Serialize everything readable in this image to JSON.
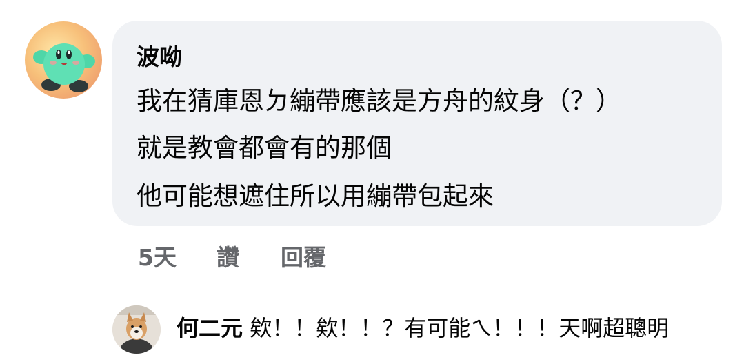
{
  "comment": {
    "author": "波呦",
    "lines": [
      "我在猜庫恩ㄉ繃帶應該是方舟的紋身（？）",
      "就是教會都會有的那個",
      "他可能想遮住所以用繃帶包起來"
    ]
  },
  "actions": {
    "time": "5天",
    "like": "讚",
    "reply": "回覆"
  },
  "reply": {
    "author": "何二元",
    "text": "欸！！欸！！？有可能ㄟ！！！天啊超聰明"
  }
}
